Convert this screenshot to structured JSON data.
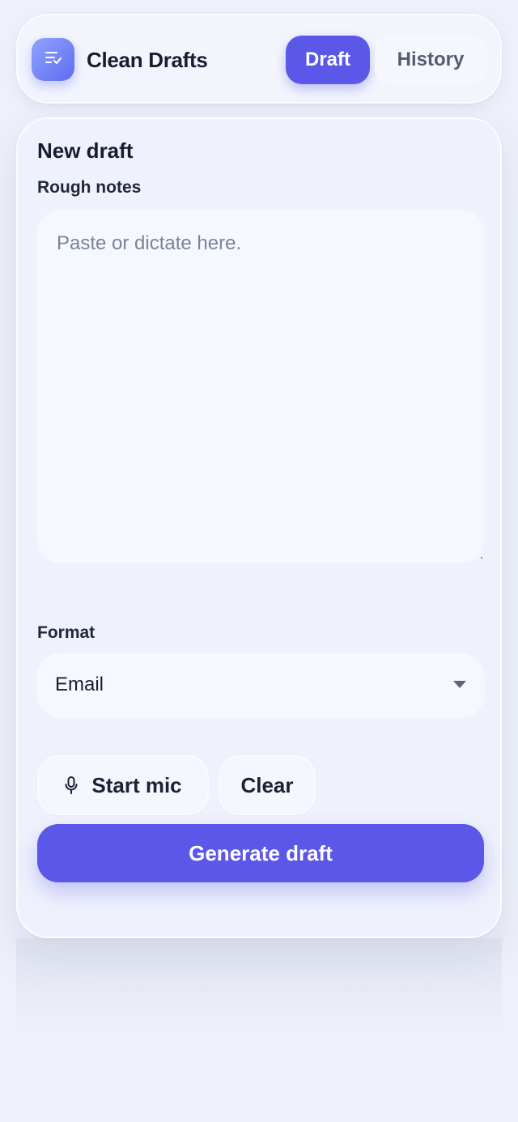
{
  "header": {
    "app_title": "Clean Drafts",
    "logo_icon": "list-check-icon",
    "tabs": [
      {
        "label": "Draft",
        "active": true
      },
      {
        "label": "History",
        "active": false
      }
    ]
  },
  "card": {
    "title": "New draft",
    "notes": {
      "label": "Rough notes",
      "value": "",
      "placeholder": "Paste or dictate here."
    },
    "format": {
      "label": "Format",
      "selected": "Email"
    },
    "actions": {
      "mic_label": "Start mic",
      "mic_icon": "microphone-icon",
      "clear_label": "Clear",
      "generate_label": "Generate draft"
    }
  },
  "colors": {
    "accent": "#5b57e8",
    "background": "#eef1fa",
    "logo_gradient_start": "#8fa4ff",
    "logo_gradient_end": "#5f6cf0"
  }
}
